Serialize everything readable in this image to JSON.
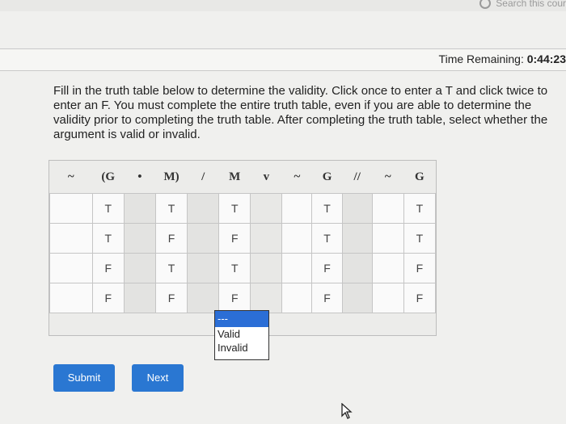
{
  "header": {
    "search_label": "Search this cour",
    "time_label": "Time Remaining:",
    "time_value": "0:44:23"
  },
  "instructions": "Fill in the truth table below to determine the validity. Click once to enter a T and click twice to enter an F. You must complete the entire truth table, even if you are able to determine the validity prior to completing the truth table. After completing the truth table, select whether the argument is valid or invalid.",
  "table": {
    "headers": [
      "~",
      "(G",
      "•",
      "M)",
      "/",
      "M",
      "v",
      "~",
      "G",
      "//",
      "~",
      "G"
    ],
    "rows": [
      [
        "",
        "T",
        "",
        "T",
        "",
        "T",
        "",
        "",
        "T",
        "",
        "",
        "T"
      ],
      [
        "",
        "T",
        "",
        "F",
        "",
        "F",
        "",
        "",
        "T",
        "",
        "",
        "T"
      ],
      [
        "",
        "F",
        "",
        "T",
        "",
        "T",
        "",
        "",
        "F",
        "",
        "",
        "F"
      ],
      [
        "",
        "F",
        "",
        "F",
        "",
        "F",
        "",
        "",
        "F",
        "",
        "",
        "F"
      ]
    ]
  },
  "validity_select": {
    "options": [
      "---",
      "Valid",
      "Invalid"
    ],
    "selected": "---"
  },
  "buttons": {
    "submit": "Submit",
    "next": "Next"
  },
  "colors": {
    "accent": "#2a77d2",
    "selected_option": "#2b6ed6"
  },
  "icons": {
    "search": "search-icon",
    "cursor": "mouse-pointer-icon"
  }
}
